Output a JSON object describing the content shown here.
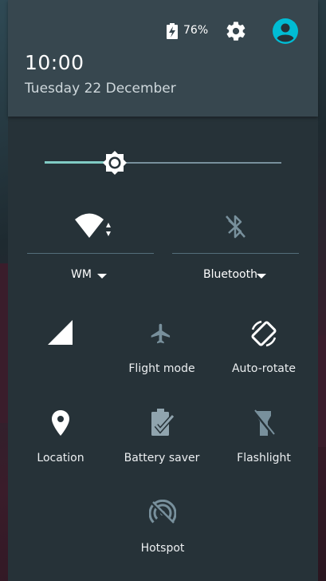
{
  "status": {
    "battery_percent": "76%"
  },
  "header": {
    "time": "10:00",
    "date": "Tuesday 22 December"
  },
  "brightness": {
    "level": 0.3
  },
  "wifi": {
    "network": "WM"
  },
  "bluetooth": {
    "label": "Bluetooth"
  },
  "tiles": [
    {
      "label": "",
      "icon": "cell-signal-icon"
    },
    {
      "label": "Flight mode",
      "icon": "airplane-icon"
    },
    {
      "label": "Auto-rotate",
      "icon": "auto-rotate-icon"
    },
    {
      "label": "Location",
      "icon": "location-icon"
    },
    {
      "label": "Battery saver",
      "icon": "battery-saver-icon"
    },
    {
      "label": "Flashlight",
      "icon": "flashlight-icon"
    },
    {
      "label": "Hotspot",
      "icon": "hotspot-icon"
    }
  ],
  "colors": {
    "accent": "#80cbc4",
    "avatar": "#00bcd4",
    "header": "#37474f",
    "panel": "#263238"
  }
}
